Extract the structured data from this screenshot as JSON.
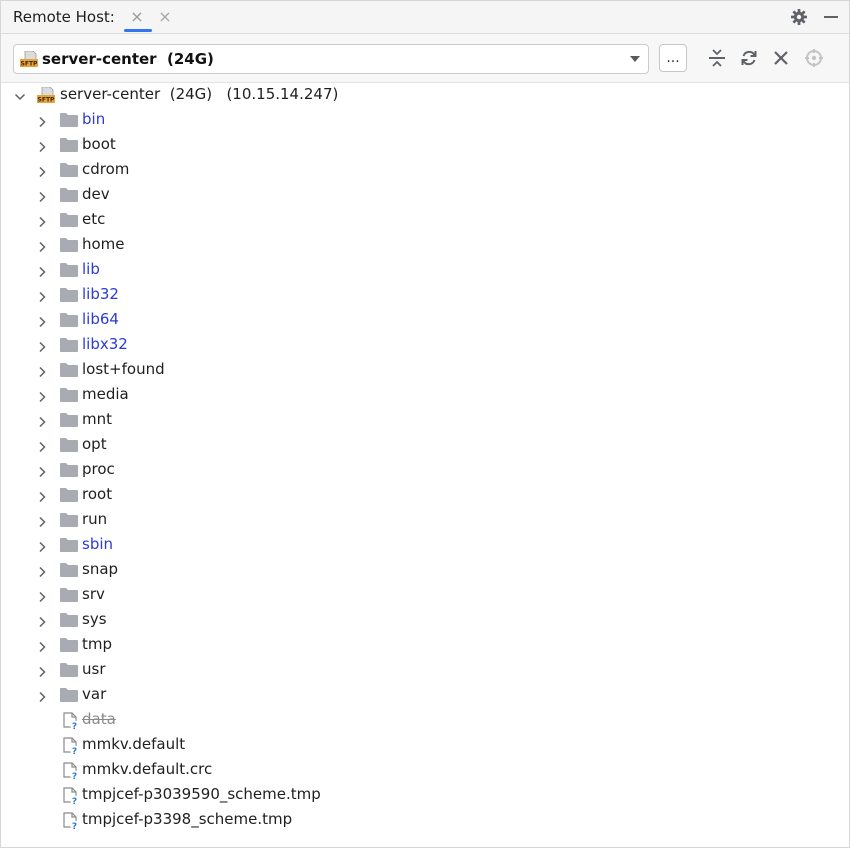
{
  "panel": {
    "title": "Remote Host:",
    "tab_close_glyph": "×"
  },
  "toolbar": {
    "host_label": "server-center  (24G)",
    "more_label": "..."
  },
  "tree": {
    "root_label": "server-center  (24G)   (10.15.14.247)",
    "folders": [
      {
        "name": "bin",
        "symlink": true
      },
      {
        "name": "boot",
        "symlink": false
      },
      {
        "name": "cdrom",
        "symlink": false
      },
      {
        "name": "dev",
        "symlink": false
      },
      {
        "name": "etc",
        "symlink": false
      },
      {
        "name": "home",
        "symlink": false
      },
      {
        "name": "lib",
        "symlink": true
      },
      {
        "name": "lib32",
        "symlink": true
      },
      {
        "name": "lib64",
        "symlink": true
      },
      {
        "name": "libx32",
        "symlink": true
      },
      {
        "name": "lost+found",
        "symlink": false
      },
      {
        "name": "media",
        "symlink": false
      },
      {
        "name": "mnt",
        "symlink": false
      },
      {
        "name": "opt",
        "symlink": false
      },
      {
        "name": "proc",
        "symlink": false
      },
      {
        "name": "root",
        "symlink": false
      },
      {
        "name": "run",
        "symlink": false
      },
      {
        "name": "sbin",
        "symlink": true
      },
      {
        "name": "snap",
        "symlink": false
      },
      {
        "name": "srv",
        "symlink": false
      },
      {
        "name": "sys",
        "symlink": false
      },
      {
        "name": "tmp",
        "symlink": false
      },
      {
        "name": "usr",
        "symlink": false
      },
      {
        "name": "var",
        "symlink": false
      }
    ],
    "files": [
      {
        "name": "data",
        "strikethrough": true
      },
      {
        "name": "mmkv.default",
        "strikethrough": false
      },
      {
        "name": "mmkv.default.crc",
        "strikethrough": false
      },
      {
        "name": "tmpjcef-p3039590_scheme.tmp",
        "strikethrough": false
      },
      {
        "name": "tmpjcef-p3398_scheme.tmp",
        "strikethrough": false
      }
    ]
  },
  "icons": {
    "settings": "gear-icon",
    "minimize": "minimize-icon",
    "collapse": "collapse-all-icon",
    "refresh": "refresh-icon",
    "close": "close-icon",
    "locate": "locate-icon",
    "folder": "folder-icon",
    "file": "unknown-file-icon",
    "sftp": "sftp-icon"
  },
  "colors": {
    "link_text": "#2a3bd6",
    "folder_fill": "#a8abb2",
    "accent": "#3574f0",
    "sftp_orange": "#e8a33d"
  }
}
